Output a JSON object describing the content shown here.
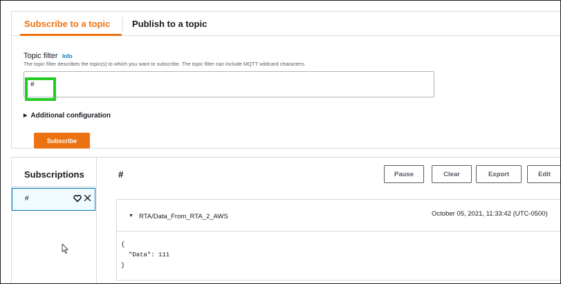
{
  "tabs": {
    "subscribe_label": "Subscribe to a topic",
    "publish_label": "Publish to a topic"
  },
  "subscribe_form": {
    "topic_filter_label": "Topic filter",
    "info_link": "Info",
    "description": "The topic filter describes the topic(s) to which you want to subscribe. The topic filter can include MQTT wildcard characters.",
    "topic_filter_value": "#",
    "additional_configuration_label": "Additional configuration",
    "subscribe_button": "Subscribe"
  },
  "subscriptions": {
    "title": "Subscriptions",
    "items": [
      {
        "name": "#",
        "favorite_icon": "heart-icon",
        "remove_icon": "close-icon"
      }
    ]
  },
  "message_view": {
    "topic_title": "#",
    "buttons": {
      "pause": "Pause",
      "clear": "Clear",
      "export": "Export",
      "edit": "Edit"
    },
    "messages": [
      {
        "topic": "RTA/Data_From_RTA_2_AWS",
        "timestamp": "October 05, 2021, 11:33:42 (UTC-0500)",
        "payload": "{\n  \"Data\": 111\n}"
      }
    ]
  },
  "colors": {
    "accent": "#ec7211",
    "highlight_box": "#22cc22",
    "link": "#0073bb"
  }
}
